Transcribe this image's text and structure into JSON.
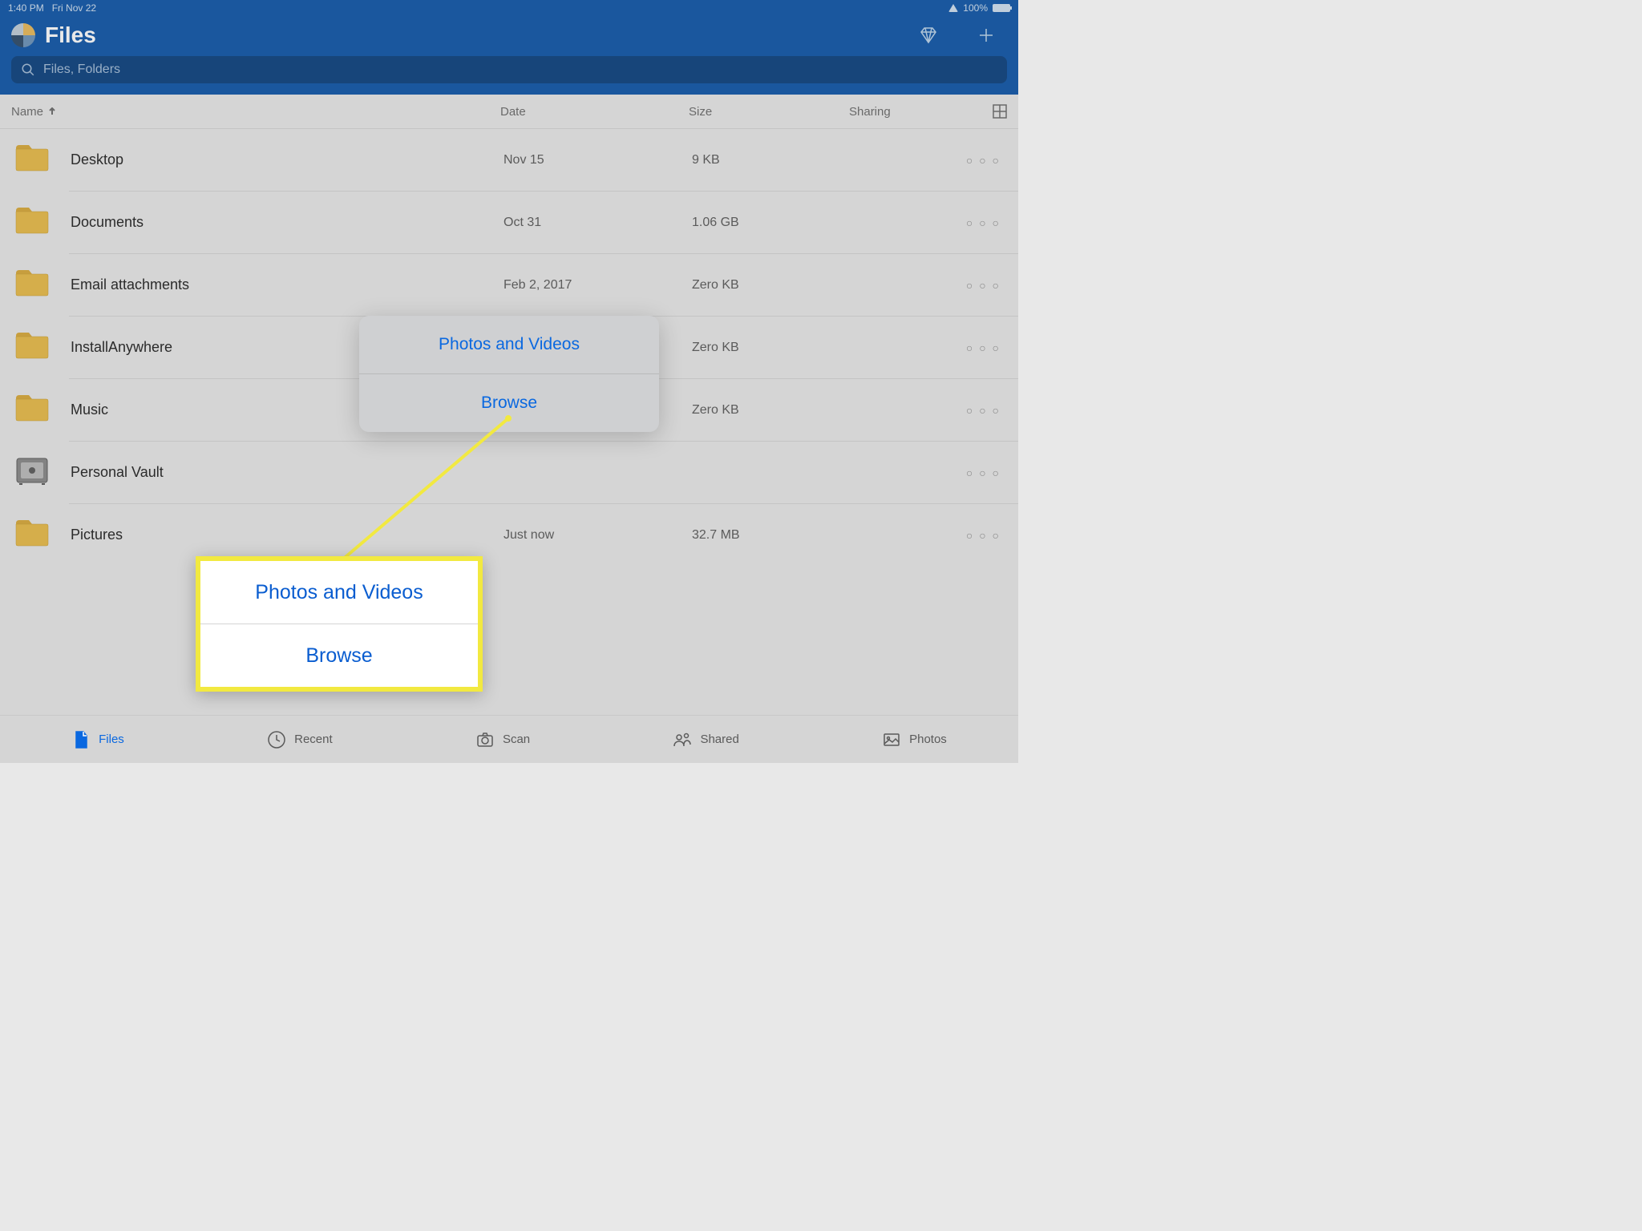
{
  "status": {
    "time": "1:40 PM",
    "date": "Fri Nov 22",
    "battery": "100%"
  },
  "header": {
    "title": "Files"
  },
  "search": {
    "placeholder": "Files, Folders"
  },
  "columns": {
    "name": "Name",
    "date": "Date",
    "size": "Size",
    "sharing": "Sharing"
  },
  "rows": [
    {
      "name": "Desktop",
      "date": "Nov 15",
      "size": "9 KB",
      "icon": "folder"
    },
    {
      "name": "Documents",
      "date": "Oct 31",
      "size": "1.06 GB",
      "icon": "folder"
    },
    {
      "name": "Email attachments",
      "date": "Feb 2, 2017",
      "size": "Zero KB",
      "icon": "folder"
    },
    {
      "name": "InstallAnywhere",
      "date": "",
      "size": "Zero KB",
      "icon": "folder"
    },
    {
      "name": "Music",
      "date": "",
      "size": "Zero KB",
      "icon": "folder"
    },
    {
      "name": "Personal Vault",
      "date": "",
      "size": "",
      "icon": "vault"
    },
    {
      "name": "Pictures",
      "date": "Just now",
      "size": "32.7 MB",
      "icon": "folder"
    }
  ],
  "popover": {
    "item1": "Photos and Videos",
    "item2": "Browse"
  },
  "callout": {
    "item1": "Photos and Videos",
    "item2": "Browse"
  },
  "tabs": {
    "files": "Files",
    "recent": "Recent",
    "scan": "Scan",
    "shared": "Shared",
    "photos": "Photos"
  }
}
